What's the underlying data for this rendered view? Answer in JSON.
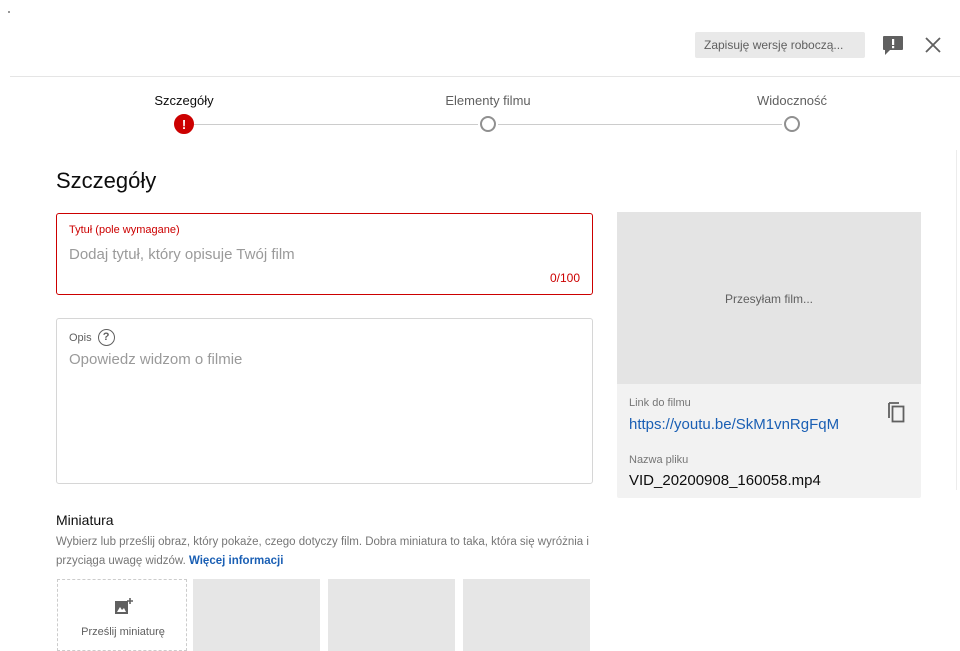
{
  "header": {
    "saving_status": "Zapisuję wersję roboczą...",
    "feedback_icon": "feedback-icon",
    "close_icon": "close-icon"
  },
  "stepper": {
    "steps": [
      {
        "label": "Szczegóły",
        "state": "error"
      },
      {
        "label": "Elementy filmu",
        "state": "pending"
      },
      {
        "label": "Widoczność",
        "state": "pending"
      }
    ]
  },
  "details": {
    "heading": "Szczegóły",
    "title_field": {
      "label": "Tytuł (pole wymagane)",
      "placeholder": "Dodaj tytuł, który opisuje Twój film",
      "char_count": "0/100"
    },
    "description_field": {
      "label": "Opis",
      "help_icon": "?",
      "placeholder": "Opowiedz widzom o filmie"
    }
  },
  "video": {
    "status": "Przesyłam film...",
    "link_label": "Link do filmu",
    "link": "https://youtu.be/SkM1vnRgFqM",
    "filename_label": "Nazwa pliku",
    "filename": "VID_20200908_160058.mp4"
  },
  "thumbnail": {
    "title": "Miniatura",
    "description": "Wybierz lub prześlij obraz, który pokaże, czego dotyczy film. Dobra miniatura to taka, która się wyróżnia i przyciąga uwagę widzów.",
    "more_link": "Więcej informacji",
    "upload_label": "Prześlij miniaturę"
  },
  "colors": {
    "error": "#cc0000",
    "link": "#1a5fb4",
    "panel": "#f2f2f2"
  }
}
